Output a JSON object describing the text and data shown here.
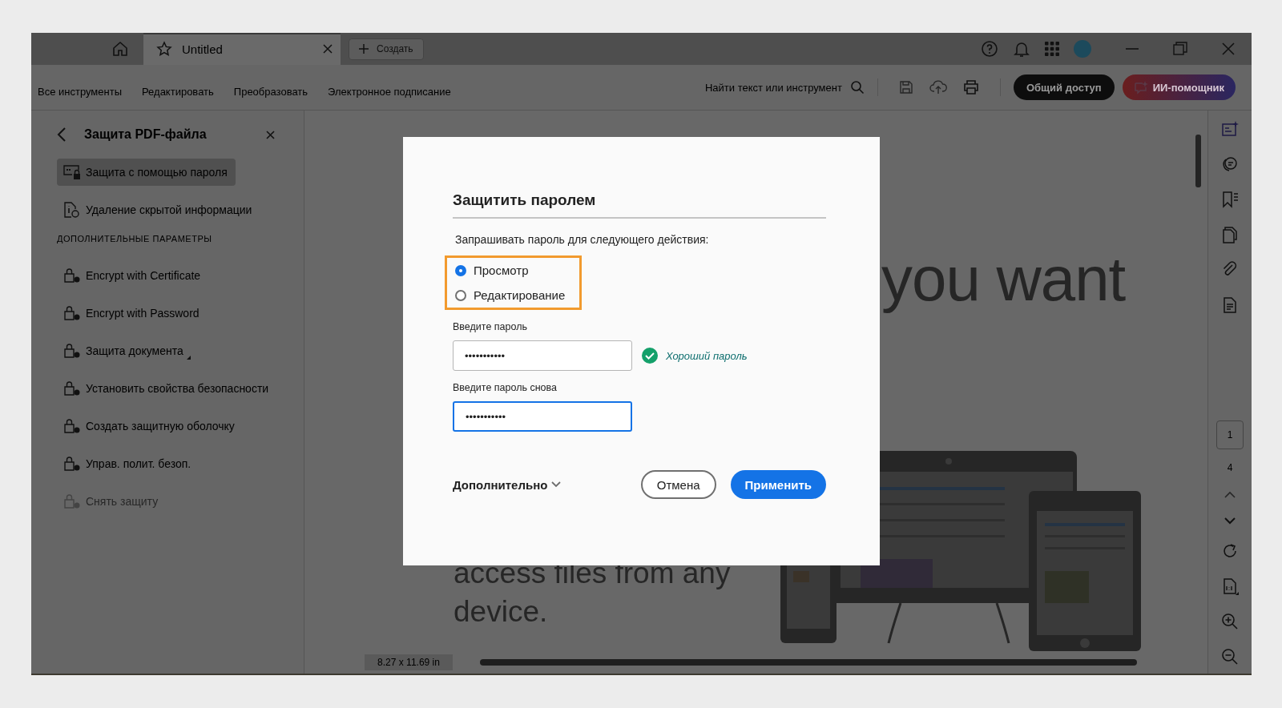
{
  "tabs": [
    {
      "label": "Untitled",
      "selected": true
    }
  ],
  "new_tab_button": "Создать",
  "menu": [
    "Все инструменты",
    "Редактировать",
    "Преобразовать",
    "Электронное подписание"
  ],
  "search": {
    "placeholder": "Найти текст или инструмент"
  },
  "share_button": "Общий доступ",
  "ai_button": "ИИ-помощник",
  "panel": {
    "title": "Защита PDF-файла",
    "items": [
      {
        "label": "Защита с помощью пароля",
        "selected": true,
        "disabled": false
      },
      {
        "label": "Удаление скрытой информации",
        "selected": false,
        "disabled": false
      }
    ],
    "section_title": "ДОПОЛНИТЕЛЬНЫЕ ПАРАМЕТРЫ",
    "more_items": [
      {
        "label": "Encrypt with Certificate",
        "disabled": false
      },
      {
        "label": "Encrypt with Password",
        "disabled": false
      },
      {
        "label": "Защита документа",
        "disabled": false
      },
      {
        "label": "Установить свойства безопасности",
        "disabled": false
      },
      {
        "label": "Создать защитную оболочку",
        "disabled": false
      },
      {
        "label": "Управ. полит. безоп.",
        "disabled": false
      },
      {
        "label": "Снять защиту",
        "disabled": true
      }
    ]
  },
  "document": {
    "heading_fragment": "you want",
    "body_lines": [
      "access files from any",
      "device."
    ],
    "page_size": "8.27 x 11.69 in"
  },
  "page_nav": {
    "current": "1",
    "total": "4"
  },
  "dialog": {
    "title": "Защитить паролем",
    "prompt": "Запрашивать пароль для следующего действия:",
    "options": [
      {
        "label": "Просмотр",
        "selected": true
      },
      {
        "label": "Редактирование",
        "selected": false
      }
    ],
    "fields": [
      {
        "label": "Введите пароль",
        "value": "•••••••••••",
        "focused": false,
        "strength": "Хороший пароль"
      },
      {
        "label": "Введите пароль снова",
        "value": "•••••••••••",
        "focused": true
      }
    ],
    "more": "Дополнительно",
    "cancel": "Отмена",
    "apply": "Применить"
  }
}
